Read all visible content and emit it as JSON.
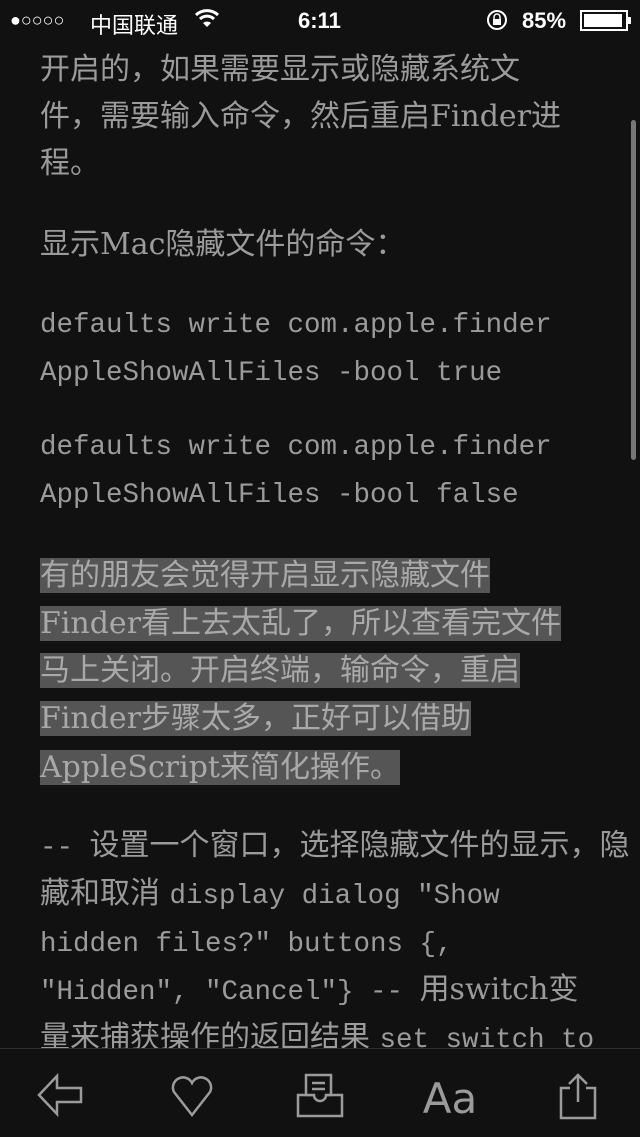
{
  "status": {
    "signal": "●○○○○",
    "carrier": "中国联通",
    "time": "6:11",
    "battery": "85%"
  },
  "article": {
    "para1": [
      "开启的，如果需要显示或隐藏系统文",
      "件，需要输入命令，然后重启Finder进",
      "程。"
    ],
    "para2": "显示Mac隐藏文件的命令：",
    "code1": [
      "defaults write com.apple.finder",
      "AppleShowAllFiles -bool true"
    ],
    "code2": [
      "defaults write com.apple.finder",
      "AppleShowAllFiles -bool false"
    ],
    "highlighted": [
      "有的朋友会觉得开启显示隐藏文件",
      "Finder看上去太乱了，所以查看完文件",
      "马上关闭。开启终端，输命令，重启",
      "Finder步骤太多，正好可以借助",
      "AppleScript来简化操作。"
    ],
    "script": [
      [
        {
          "t": "-- ",
          "m": 1
        },
        {
          "t": "设置一个窗口，选择隐藏文件的显示，隐",
          "m": 0
        }
      ],
      [
        {
          "t": "藏和取消 ",
          "m": 0
        },
        {
          "t": "display dialog \"Show",
          "m": 1
        }
      ],
      [
        {
          "t": "hidden files?\" buttons {,",
          "m": 1
        }
      ],
      [
        {
          "t": "\"Hidden\", \"Cancel\"} -- ",
          "m": 1
        },
        {
          "t": "用switch变",
          "m": 0
        }
      ],
      [
        {
          "t": "量来捕获操作的返回结果 ",
          "m": 0
        },
        {
          "t": "set switch to",
          "m": 1
        }
      ]
    ]
  },
  "toolbar": {
    "font_label": "Aa"
  }
}
